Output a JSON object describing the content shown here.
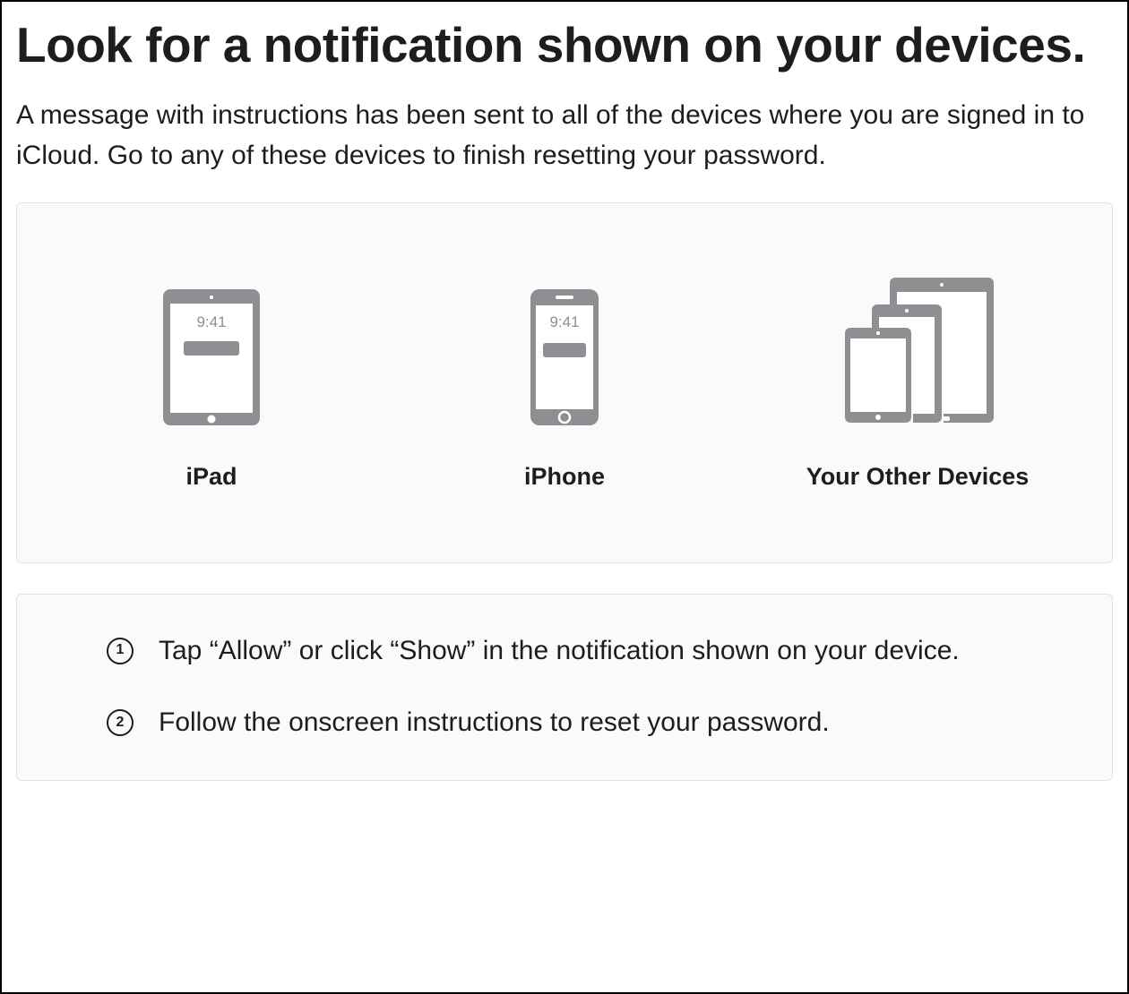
{
  "title": "Look for a notification shown on your devices.",
  "subtitle": "A message with instructions has been sent to all of the devices where you are signed in to iCloud. Go to any of these devices to finish resetting your password.",
  "devices": [
    {
      "label": "iPad",
      "time": "9:41"
    },
    {
      "label": "iPhone",
      "time": "9:41"
    },
    {
      "label": "Your Other Devices"
    }
  ],
  "steps": [
    {
      "num": "1",
      "text": "Tap “Allow” or click “Show” in the notification shown on your device."
    },
    {
      "num": "2",
      "text": "Follow the onscreen instructions to reset your password."
    }
  ],
  "colors": {
    "icon_gray": "#8e8e93",
    "panel_bg": "#fafafa",
    "border": "#e2e2e2"
  }
}
